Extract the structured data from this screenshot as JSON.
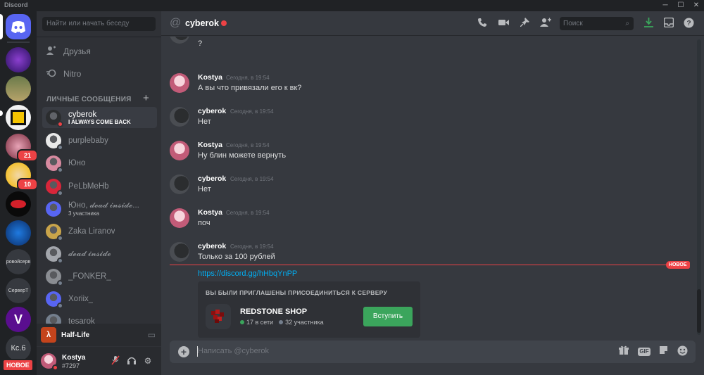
{
  "app": {
    "name": "Discord"
  },
  "window_controls": {
    "minimize": "─",
    "maximize": "☐",
    "close": "✕"
  },
  "rail": {
    "badges": [
      "21",
      "10"
    ],
    "text_servers": [
      "ровойсерв",
      "СерверТ",
      "Кс.6"
    ],
    "new_badge": "НОВОЕ"
  },
  "sidebar": {
    "search_placeholder": "Найти или начать беседу",
    "nav": [
      {
        "label": "Друзья",
        "icon": "friends-icon"
      },
      {
        "label": "Nitro",
        "icon": "nitro-icon"
      }
    ],
    "section_title": "ЛИЧНЫЕ СООБЩЕНИЯ",
    "dms": [
      {
        "name": "cyberok",
        "sub": "I ALWAYS COME BACK",
        "status": "dnd",
        "color": "#2b2d2f"
      },
      {
        "name": "purplebaby",
        "sub": "",
        "status": "offline",
        "color": "#e9e9e9"
      },
      {
        "name": "Юно",
        "sub": "",
        "status": "offline",
        "color": "#d88aa0"
      },
      {
        "name": "PeLbMeHb",
        "sub": "",
        "status": "offline",
        "color": "#d8263a"
      },
      {
        "name": "Юно, 𝓭𝓮𝓪𝓭 𝓲𝓷𝓼𝓲𝓭𝓮...",
        "sub": "3 участника",
        "status": "none",
        "color": "#5865f2"
      },
      {
        "name": "Zaka Liranov",
        "sub": "",
        "status": "offline",
        "color": "#c9a44a"
      },
      {
        "name": "𝓭𝓮𝓪𝓭 𝓲𝓷𝓼𝓲𝓭𝓮",
        "sub": "",
        "status": "offline",
        "color": "#a3a6ac"
      },
      {
        "name": "_FONKER_",
        "sub": "",
        "status": "offline",
        "color": "#8a8d92"
      },
      {
        "name": "Xoriix_",
        "sub": "",
        "status": "offline",
        "color": "#5865f2"
      },
      {
        "name": "tesarok",
        "sub": "",
        "status": "offline",
        "color": "#747f8d"
      }
    ]
  },
  "activity": {
    "game": "Half-Life",
    "icon_glyph": "λ"
  },
  "user": {
    "name": "Kostya",
    "tag": "#7297"
  },
  "chat": {
    "recipient": "cyberok",
    "search_placeholder": "Поиск",
    "top_partial_text": "?",
    "messages": [
      {
        "author": "Kostya",
        "time": "Сегодня, в 19:54",
        "text": "А вы что привязали его к вк?"
      },
      {
        "author": "cyberok",
        "time": "Сегодня, в 19:54",
        "text": "Нет"
      },
      {
        "author": "Kostya",
        "time": "Сегодня, в 19:54",
        "text": "Ну блин можете вернуть"
      },
      {
        "author": "cyberok",
        "time": "Сегодня, в 19:54",
        "text": "Нет"
      },
      {
        "author": "Kostya",
        "time": "Сегодня, в 19:54",
        "text": "поч"
      },
      {
        "author": "cyberok",
        "time": "Сегодня, в 19:54",
        "text": "Только  за 100 рублей"
      }
    ],
    "new_label": "НОВОЕ",
    "link": "https://discord.gg/hHbqYnPP",
    "invite": {
      "header": "ВЫ БЫЛИ ПРИГЛАШЕНЫ ПРИСОЕДИНИТЬСЯ К СЕРВЕРУ",
      "server_name": "REDSTONE SHOP",
      "online": "17 в сети",
      "members": "32 участника",
      "join_label": "Вступить"
    },
    "composer_placeholder": "Написать @cyberok",
    "composer_gif": "GIF"
  }
}
